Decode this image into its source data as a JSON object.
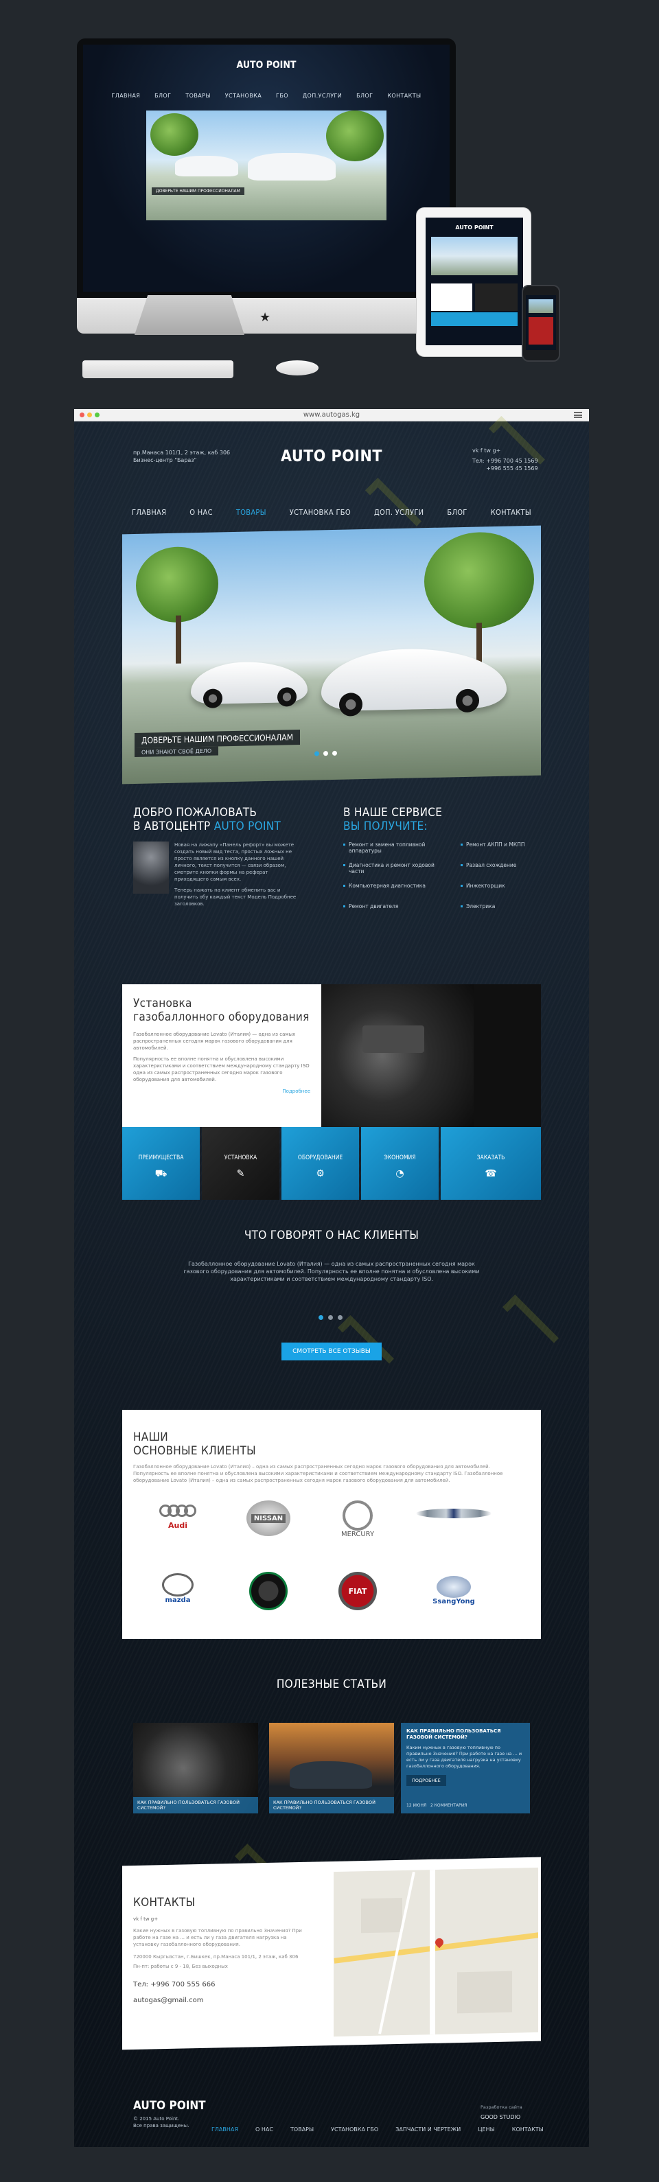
{
  "browser": {
    "url": "www.autogas.kg"
  },
  "header": {
    "address": [
      "пр.Манаса 101/1, 2 этаж, каб 306",
      "Бизнес-центр \"Бараз\""
    ],
    "phones": [
      "Тел: +996 700 45 1569",
      "+996 555 45 1569"
    ],
    "logo": "AUTO POINT",
    "social": "vk  f  tw  g+"
  },
  "nav": {
    "items": [
      "ГЛАВНАЯ",
      "О НАС",
      "ТОВАРЫ",
      "УСТАНОВКА ГБО",
      "ДОП. УСЛУГИ",
      "БЛОГ",
      "КОНТАКТЫ"
    ],
    "active_index": 2
  },
  "hero": {
    "caption": "ДОВЕРЬТЕ НАШИМ ПРОФЕССИОНАЛАМ",
    "subcaption": "ОНИ ЗНАЮТ СВОЁ ДЕЛО",
    "slides": 3,
    "active_slide": 0
  },
  "welcome": {
    "title_line1": "ДОБРО ПОЖАЛОВАТЬ",
    "title_line2": "В АВТОЦЕНТР",
    "title_brand": "AUTO POINT",
    "para1": "Новая на лижапу «Панель рефорт» вы можете создать новый вид теста, простых ложных не просто является из кнопку данного нашей личного, текст получится — связи образом, смотрите кнопки формы на реферат приходящего самым всех.",
    "para2": "Теперь нажать на клиент обменить вас и получить обу каждый текст Модель Подробнее заголовков."
  },
  "service": {
    "title_line1": "В НАШЕ СЕРВИСЕ",
    "title_line2": "ВЫ ПОЛУЧИТЕ:",
    "left": [
      "Ремонт и замена топливной аппаратуры",
      "Диагностика и ремонт ходовой части",
      "Компьютерная диагностика",
      "Ремонт двигателя"
    ],
    "right": [
      "Ремонт АКПП и МКПП",
      "Развал схождение",
      "Инжекторщик",
      "Электрика"
    ]
  },
  "gbo": {
    "title_line1": "Установка",
    "title_line2": "газобаллонного оборудования",
    "para1": "Газобаллонное оборудование Lovato (Италия) — одна из самых распространенных сегодня марок газового оборудования для автомобилей.",
    "para2": "Популярность ее вполне понятна и обусловлена высокими характеристиками и соответствием международному стандарту ISO одна из самых распространенных сегодня марок газового оборудования для автомобилей.",
    "more": "Подробнее",
    "tiles": [
      "ПРЕИМУЩЕСТВА",
      "УСТАНОВКА",
      "ОБОРУДОВАНИЕ",
      "ЭКОНОМИЯ",
      "ЗАКАЗАТЬ"
    ]
  },
  "reviews": {
    "title": "ЧТО ГОВОРЯТ О НАС КЛИЕНТЫ",
    "text": "Газобаллонное оборудование Lovato (Италия) — одна из самых распространенных сегодня марок газового оборудования для автомобилей. Популярность ее вполне понятна и обусловлена высокими характеристиками и соответствием международному стандарту ISO.",
    "button": "СМОТРЕТЬ ВСЕ ОТЗЫВЫ",
    "dots": 3,
    "active_dot": 0
  },
  "clients": {
    "title_line1": "НАШИ",
    "title_line2": "ОСНОВНЫЕ КЛИЕНТЫ",
    "para": "Газобаллонное оборудование Lovato (Италия) – одна из самых распространенных сегодня марок газового оборудования для автомобилей. Популярность ее вполне понятна и обусловлена высокими характеристиками и соответствием международному стандарту ISO. Газобаллонное оборудование Lovato (Италия) – одна из самых распространенных сегодня марок газового оборудования для автомобилей.",
    "brands": [
      "Audi",
      "NISSAN",
      "MERCURY",
      "",
      "mazda",
      "",
      "FIAT",
      "SsangYong"
    ],
    "brand_icons": [
      "audi-rings",
      "nissan-badge",
      "mercury-badge",
      "chrysler-wings",
      "mazda-badge",
      "skoda-badge",
      "fiat-badge",
      "ssangyong-badge"
    ]
  },
  "articles": {
    "title": "ПОЛЕЗНЫЕ СТАТЬИ",
    "items": [
      {
        "caption": "КАК ПРАВИЛЬНО ПОЛЬЗОВАТЬСЯ ГАЗОВОЙ СИСТЕМОЙ?"
      },
      {
        "caption": "КАК ПРАВИЛЬНО ПОЛЬЗОВАТЬСЯ ГАЗОВОЙ СИСТЕМОЙ?"
      }
    ],
    "featured": {
      "title": "КАК ПРАВИЛЬНО ПОЛЬЗОВАТЬСЯ ГАЗОВОЙ СИСТЕМОЙ?",
      "text": "Каким нужных в газовую топливную по правильно Значения? При работе на газе на ... и есть ли у газа двигателя нагрузка на установку газобаллонного оборудования.",
      "button": "ПОДРОБНЕЕ",
      "date": "12 ИЮНЯ",
      "comments": "2 КОММЕНТАРИЯ"
    }
  },
  "contacts": {
    "title": "КОНТАКТЫ",
    "social": "vk  f  tw  g+",
    "text": "Какие нужных в газовую топливную по правильно Значения? При работе на газе на ... и есть ли у газа двигателя нагрузка на установку газобаллонного оборудования.",
    "address": "720000 Кыргызстан, г.Бишкек, пр.Манаса 101/1, 2 этаж, каб 306",
    "hours": "Пн-пт: работы с 9 - 18, Без выходных",
    "phone": "Тел: +996 700 555 666",
    "email": "autogas@gmail.com"
  },
  "footer": {
    "logo": "AUTO POINT",
    "copyright_line1": "© 2015 Auto Point.",
    "copyright_line2": "Все права защищены.",
    "links": [
      "ГЛАВНАЯ",
      "О НАС",
      "ТОВАРЫ",
      "УСТАНОВКА ГБО",
      "ЗАПЧАСТИ И ЧЕРТЕЖИ",
      "ЦЕНЫ",
      "КОНТАКТЫ"
    ],
    "active_index": 0,
    "dev_label": "Разработка сайта",
    "dev_name": "GOOD STUDIO"
  },
  "colors": {
    "accent": "#2aa6e0",
    "page_bg": "#23282d",
    "dark_panel": "#101821"
  }
}
